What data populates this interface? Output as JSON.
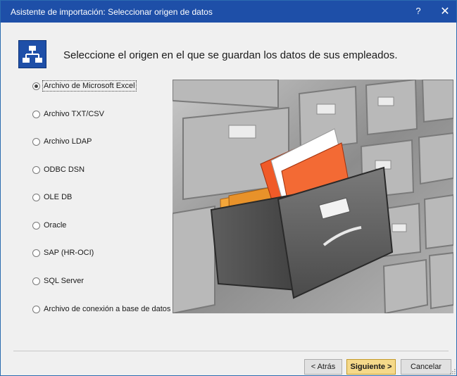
{
  "window": {
    "title": "Asistente de importación: Seleccionar origen de datos",
    "help_glyph": "?",
    "close_glyph": "✕"
  },
  "header": {
    "icon": "network-diagram-icon",
    "text": "Seleccione el origen en el que se guardan los datos de sus empleados."
  },
  "options": {
    "selected": "Archivo de Microsoft Excel",
    "items": [
      {
        "label": "Archivo de Microsoft Excel",
        "checked": true
      },
      {
        "label": "Archivo TXT/CSV",
        "checked": false
      },
      {
        "label": "Archivo LDAP",
        "checked": false
      },
      {
        "label": "ODBC DSN",
        "checked": false
      },
      {
        "label": "OLE DB",
        "checked": false
      },
      {
        "label": "Oracle",
        "checked": false
      },
      {
        "label": "SAP (HR-OCI)",
        "checked": false
      },
      {
        "label": "SQL Server",
        "checked": false
      },
      {
        "label": "Archivo de conexión a base de datos",
        "checked": false
      }
    ]
  },
  "illustration": {
    "icon": "file-cabinet-drawer-illustration"
  },
  "buttons": {
    "back": "< Atrás",
    "next": "Siguiente >",
    "cancel": "Cancelar"
  },
  "colors": {
    "titlebar": "#1e4fa8",
    "primary_button": "#f5d98a",
    "folder": "#f05a28"
  }
}
